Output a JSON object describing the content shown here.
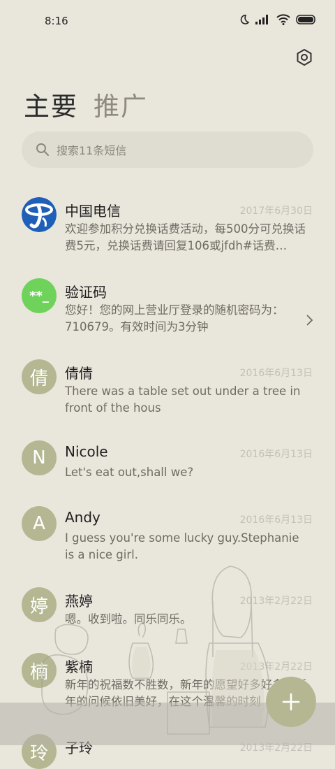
{
  "status_bar": {
    "time": "8:16"
  },
  "tabs": {
    "primary": "主要",
    "promo": "推广"
  },
  "search": {
    "placeholder": "搜索11条短信"
  },
  "messages": [
    {
      "avatar": "",
      "name": "中国电信",
      "date": "2017年6月30日",
      "text": "欢迎参加积分兑换话费活动，每500分可兑换话费5元，兑换话费请回复106或jfdh#话费…"
    },
    {
      "avatar": "**_",
      "name": "验证码",
      "date": "",
      "text": "您好！您的网上营业厅登录的随机密码为：710679。有效时间为3分钟"
    },
    {
      "avatar": "倩",
      "name": "倩倩",
      "date": "2016年6月13日",
      "text": "There was a table set out under a tree in front of the hous"
    },
    {
      "avatar": "N",
      "name": "Nicole",
      "date": "2016年6月13日",
      "text": "Let's eat out,shall we?"
    },
    {
      "avatar": "A",
      "name": "Andy",
      "date": "2016年6月13日",
      "text": "I guess you're some lucky guy.Stephanie is a nice girl."
    },
    {
      "avatar": "婷",
      "name": "燕婷",
      "date": "2013年2月22日",
      "text": "嗯。收到啦。同乐同乐。"
    },
    {
      "avatar": "楠",
      "name": "紫楠",
      "date": "2013年2月22日",
      "text": "新年的祝福数不胜数，新年的愿望好多好多，新年的问候依旧美好，在这个温馨的时刻"
    },
    {
      "avatar": "玲",
      "name": "子玲",
      "date": "2013年2月22日",
      "text": ""
    }
  ],
  "colors": {
    "background": "#e9e6dc",
    "avatar": "#b5b793",
    "verify_avatar": "#6fd35b",
    "telecom_blue": "#1f5fb8"
  }
}
